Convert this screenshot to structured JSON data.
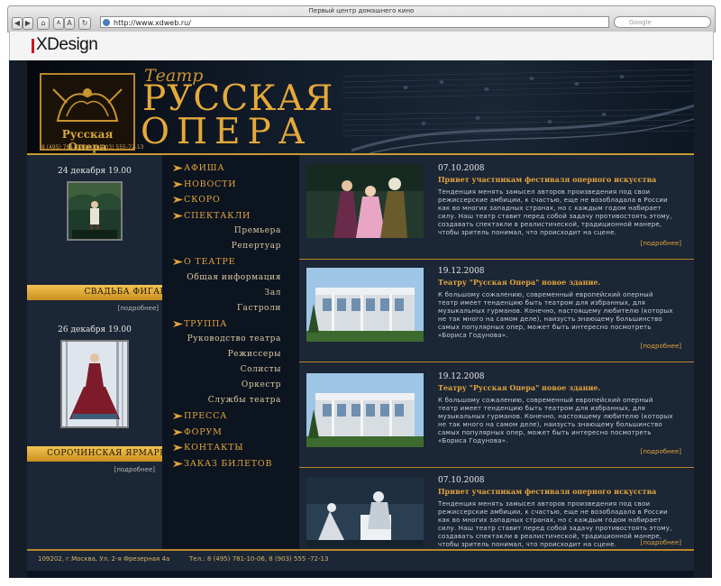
{
  "browser": {
    "window_title": "Первый центр домашнего кино",
    "url": "http://www.xdweb.ru/",
    "search_placeholder": "Google",
    "nav_back": "◀",
    "nav_forward": "▶",
    "home_icon": "⌂",
    "text_small": "A",
    "text_large": "A",
    "reload": "↻"
  },
  "brand": {
    "name": "XDesign",
    "accent": "#d2161b"
  },
  "header": {
    "theatre_word": "Театр",
    "title_line1": "РУССКАЯ",
    "title_line2": "ОПЕРА",
    "logo_caption": "Русская Опера",
    "phones": "8 (495) 781-10-06, 8 (903) 555-72-13"
  },
  "events": [
    {
      "date": "24 декабря 19.00",
      "title": "СВАДЬБА ФИГАРО",
      "more": "[подробнее]"
    },
    {
      "date": "26 декабря 19.00",
      "title": "СОРОЧИНСКАЯ  ЯРМАРКА",
      "more": "[подробнее]"
    }
  ],
  "nav": {
    "afisha": "АФИША",
    "novosti": "НОВОСТИ",
    "skoro": "СКОРО",
    "spektakli": "СПЕКТАКЛИ",
    "premiera": "Премьера",
    "repertuar": "Репертуар",
    "o_teatre": "О ТЕАТРЕ",
    "obshaya": "Общая информация",
    "zal": "Зал",
    "gastroli": "Гастроли",
    "truppa": "ТРУППА",
    "rukovodstvo": "Руководство театра",
    "rezhissery": "Режиссеры",
    "solisty": "Солисты",
    "orkestr": "Оркестр",
    "sluzhby": "Службы театра",
    "pressa": "ПРЕССА",
    "forum": "ФОРУМ",
    "kontakty": "КОНТАКТЫ",
    "zakaz": "ЗАКАЗ БИЛЕТОВ"
  },
  "news": [
    {
      "date": "07.10.2008",
      "title": "Привет участникам фестиваля оперного искусства",
      "body": "Тенденция менять замысел авторов произведения под свои режиссерские амбиции, к счастью, еще не возобладала в России как во многих западных странах, но с каждым годом набирает силу. Наш театр ставит перед собой задачу противостоять этому, создавать спектакли в реалистической, традиционной манере, чтобы зритель понимал, что происходит на сцене.",
      "more": "[подробнее]"
    },
    {
      "date": "19.12.2008",
      "title": "Театру \"Русская Опера\" новое здание.",
      "body": "К большому сожалению, современный европейский оперный театр имеет тенденцию быть театром для избранных, для музыкальных гурманов. Конечно, настоящему любителю (которых не так много на самом деле), наизусть знающему большинство самых популярных опер, может быть интересно посмотреть «Бориса Годунова».",
      "more": "[подробнее]"
    },
    {
      "date": "19.12.2008",
      "title": "Театру \"Русская Опера\" новое здание.",
      "body": "К большому сожалению, современный европейский оперный театр имеет тенденцию быть театром для избранных, для музыкальных гурманов. Конечно, настоящему любителю (которых не так много на самом деле), наизусть знающему большинство самых популярных опер, может быть интересно посмотреть «Бориса Годунова».",
      "more": "[подробнее]"
    },
    {
      "date": "07.10.2008",
      "title": "Привет участникам фестиваля оперного искусства",
      "body": "Тенденция менять замысел авторов произведения под свои режиссерские амбиции, к счастью, еще не возобладала в России как во многих западных странах, но с каждым годом набирает силу. Наш театр ставит перед собой задачу противостоять этому, создавать спектакли в реалистической, традиционной манере, чтобы зритель понимал, что происходит на сцене.",
      "more": "[подробнее]"
    }
  ],
  "footer": {
    "address": "109202, г.Москва, Ул. 2-я Фрезерная 4а",
    "phones": "Тел.: 8 (495) 781-10-06, 8 (903) 555 -72-13"
  },
  "colors": {
    "gold": "#e2a43a",
    "navy": "#0b1320",
    "panel": "#1b2636"
  }
}
